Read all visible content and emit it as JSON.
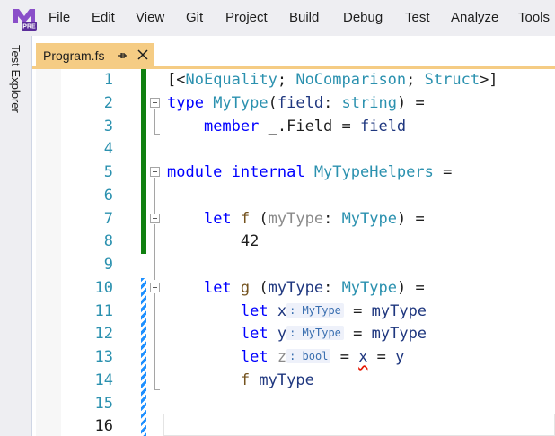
{
  "menu": {
    "logo_badge": "PRE",
    "items": [
      "File",
      "Edit",
      "View",
      "Git",
      "Project",
      "Build",
      "Debug",
      "Test",
      "Analyze",
      "Tools"
    ]
  },
  "side_panel": {
    "tab_label": "Test Explorer"
  },
  "tab": {
    "filename": "Program.fs",
    "pin_icon": "pin-icon",
    "close_icon": "close-icon",
    "active_color": "#f5cc84"
  },
  "editor": {
    "line_numbers": [
      "1",
      "2",
      "3",
      "4",
      "5",
      "6",
      "7",
      "8",
      "9",
      "10",
      "11",
      "12",
      "13",
      "14",
      "15",
      "16"
    ],
    "current_line": "16",
    "inlay_hints": {
      "x": ": MyType",
      "y": ": MyType",
      "z": ": bool"
    },
    "colors": {
      "keyword": "#0000ff",
      "type": "#2b91af",
      "saved_change": "#108010",
      "unsaved_change": "#1e90ff"
    }
  }
}
